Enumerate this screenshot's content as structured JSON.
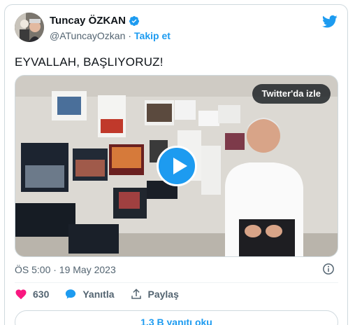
{
  "author": {
    "display_name": "Tuncay ÖZKAN",
    "handle": "@ATuncayOzkan",
    "separator": "·",
    "follow_label": "Takip et"
  },
  "tweet": {
    "text": "EYVALLAH, BAŞLIYORUZ!",
    "timestamp": "ÖS 5:00 · 19 May 2023"
  },
  "media": {
    "watch_label": "Twitter'da izle"
  },
  "actions": {
    "like_count": "630",
    "reply_label": "Yanıtla",
    "share_label": "Paylaş"
  },
  "read_replies_label": "1,3 B yanıtı oku",
  "colors": {
    "accent": "#1d9bf0",
    "like": "#f91880",
    "muted": "#536471"
  }
}
